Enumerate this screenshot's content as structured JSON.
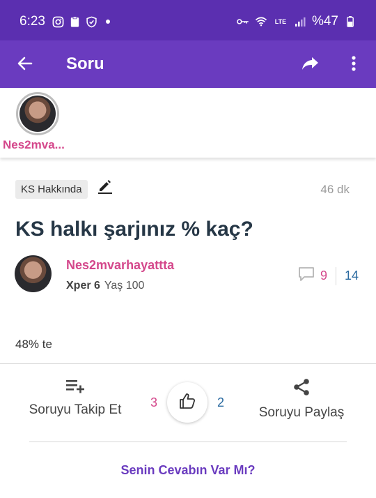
{
  "status_bar": {
    "time": "6:23",
    "battery": "%47",
    "network": "LTE"
  },
  "app_bar": {
    "title": "Soru"
  },
  "strip": {
    "name": "Nes2mva..."
  },
  "question": {
    "category": "KS Hakkında",
    "time_ago": "46 dk",
    "title": "KS halkı şarjınız % kaç?",
    "author": {
      "name": "Nes2mvarhayattta",
      "xp": "Xper 6",
      "age": "Yaş 100"
    },
    "comment_count": "9",
    "answer_count": "14",
    "body": "48% te"
  },
  "actions": {
    "follow_label": "Soruyu Takip Et",
    "vote_left": "3",
    "vote_right": "2",
    "share_label": "Soruyu Paylaş"
  },
  "cta": {
    "label": "Senin Cevabın Var Mı?"
  },
  "colors": {
    "primary": "#6a3bbf",
    "status": "#5b2fb0",
    "pink": "#d4478b",
    "blue": "#2a6aa0",
    "title": "#263746"
  },
  "icons": [
    "back-arrow-icon",
    "share-icon",
    "more-vert-icon",
    "pencil-icon",
    "comment-icon",
    "playlist-add-icon",
    "thumb-up-icon",
    "share-nodes-icon",
    "instagram-icon",
    "clipboard-icon",
    "shield-icon",
    "key-icon",
    "wifi-icon",
    "signal-icon",
    "battery-icon"
  ]
}
